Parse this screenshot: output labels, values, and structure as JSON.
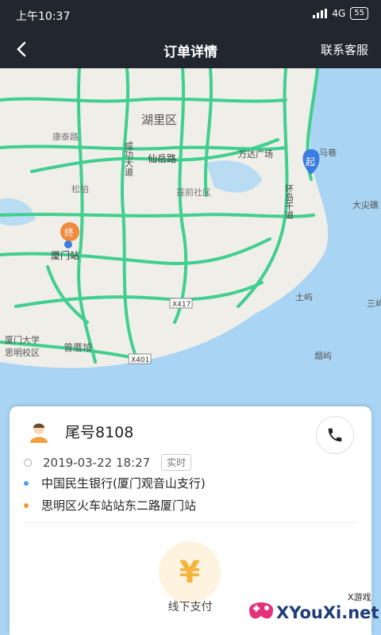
{
  "status_bar": {
    "time": "上午10:37",
    "network": "4G",
    "battery": "55"
  },
  "header": {
    "back_icon": "chevron-left-icon",
    "title": "订单详情",
    "service_label": "联系客服"
  },
  "map": {
    "labels": {
      "huli": "湖里区",
      "xianyue": "仙岳路",
      "wanda": "万达广场",
      "chenggong": "成功大道",
      "kangtai": "康泰路",
      "songbai": "松柏",
      "lianjin": "莲前社区",
      "xiamen_station": "厦门站",
      "huandao": "环岛干道",
      "mawei": "马巷",
      "daju": "大尖礁",
      "tuyu": "土屿",
      "sanyu": "三屿",
      "yanyu": "烟屿",
      "zengcuoan": "曾厝垵",
      "xmu": "厦门大学",
      "siming": "思明校区",
      "x417": "X417",
      "x401": "X401",
      "start_marker": "起",
      "end_marker": "终"
    }
  },
  "order": {
    "driver_tail": "尾号8108",
    "datetime": "2019-03-22 18:27",
    "type_badge": "实时",
    "origin": "中国民生银行(厦门观音山支行)",
    "destination": "思明区火车站站东二路厦门站",
    "pay_symbol": "¥",
    "pay_label": "线下支付"
  },
  "watermark": {
    "site": "XYouXi.net",
    "small": "X游戏"
  },
  "colors": {
    "header_bg": "#22262e",
    "road": "#3fcf8e",
    "sea": "#a9d4f3",
    "start_marker": "#3b7de0",
    "end_marker": "#f0893d",
    "origin_dot": "#4aa3e8",
    "dest_dot": "#f39a3b",
    "pay_bg": "#fdf3df",
    "pay_symbol": "#f3b33d"
  }
}
